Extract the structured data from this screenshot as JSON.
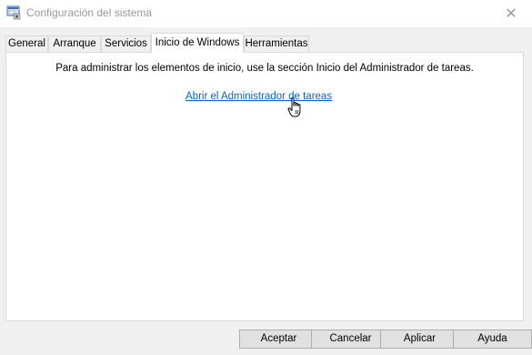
{
  "window": {
    "title": "Configuración del sistema",
    "icon": "msconfig-icon",
    "close_glyph": "✕"
  },
  "tabs": [
    {
      "label": "General",
      "active": false
    },
    {
      "label": "Arranque",
      "active": false
    },
    {
      "label": "Servicios",
      "active": false
    },
    {
      "label": "Inicio de Windows",
      "active": true
    },
    {
      "label": "Herramientas",
      "active": false
    }
  ],
  "startup_panel": {
    "message": "Para administrar los elementos de inicio, use la sección Inicio del Administrador de tareas.",
    "link_label": "Abrir el Administrador de tareas"
  },
  "buttons": {
    "accept": "Aceptar",
    "cancel": "Cancelar",
    "apply": "Aplicar",
    "help": "Ayuda"
  },
  "colors": {
    "link": "#0066cc",
    "panel": "#ffffff",
    "window": "#f0f0f0"
  }
}
